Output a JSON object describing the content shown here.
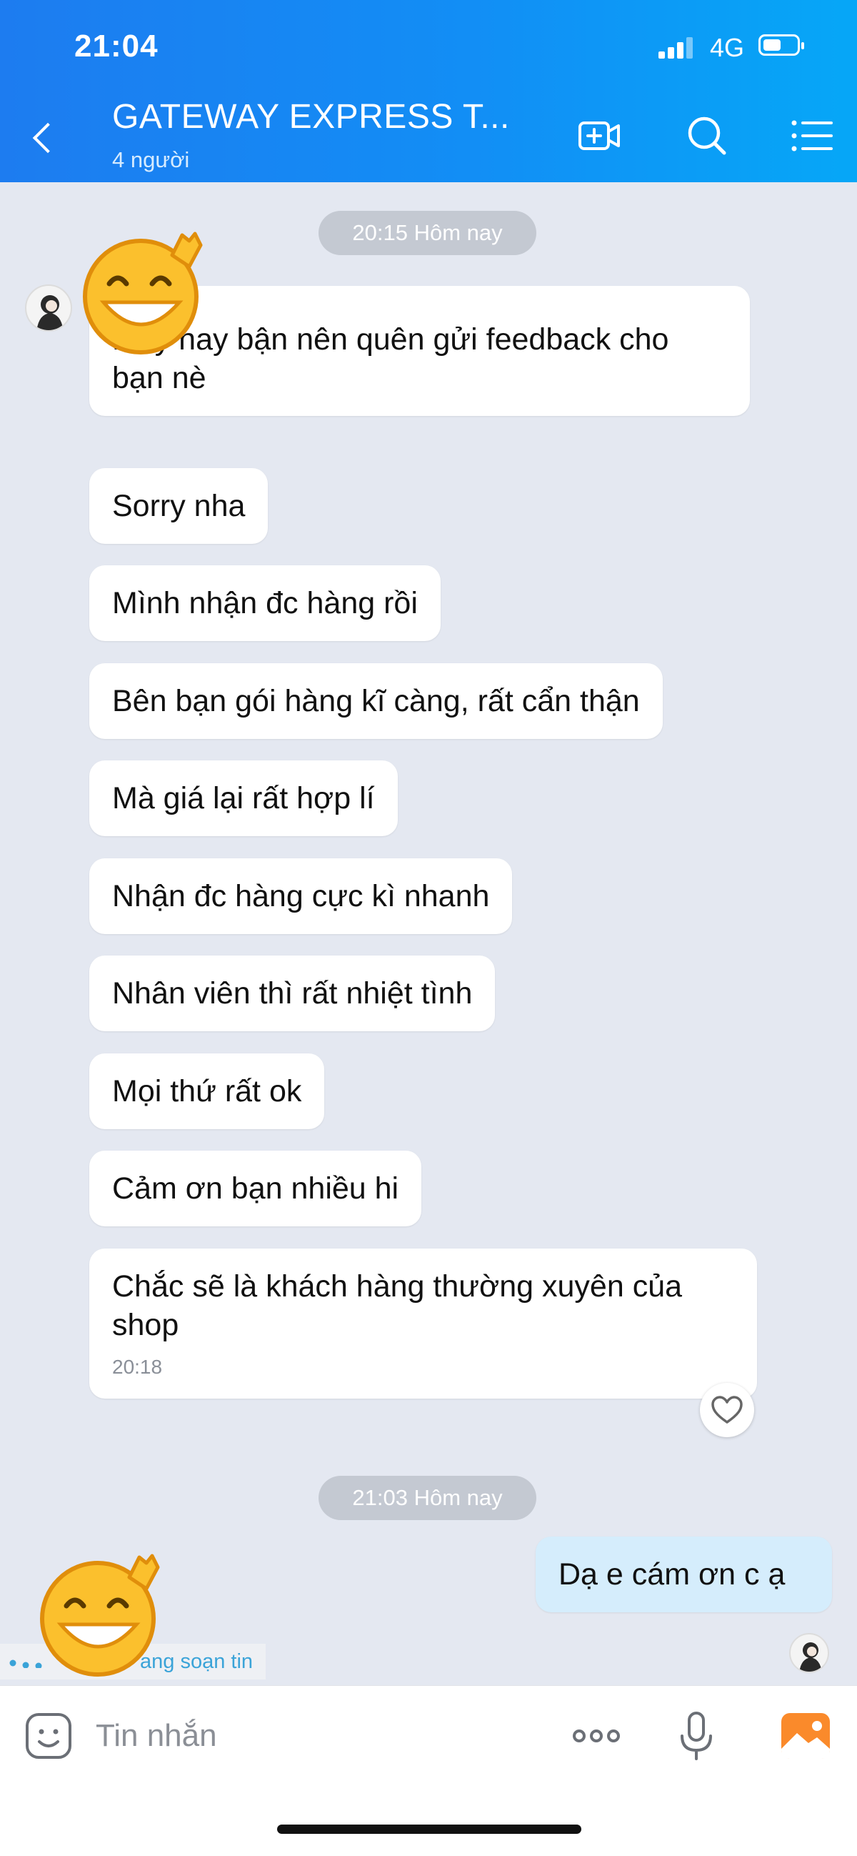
{
  "status_bar": {
    "time": "21:04",
    "network": "4G"
  },
  "header": {
    "title": "GATEWAY EXPRESS  T...",
    "subtitle": "4 người"
  },
  "chat": {
    "date_1": "20:15 Hôm nay",
    "messages": [
      {
        "text": "Mấy nay bận nên quên gửi feedback cho bạn nè"
      },
      {
        "text": "Sorry nha"
      },
      {
        "text": "Mình nhận đc hàng rồi"
      },
      {
        "text": "Bên bạn gói hàng kĩ càng, rất cẩn thận"
      },
      {
        "text": "Mà giá lại rất hợp lí"
      },
      {
        "text": "Nhận đc hàng cực kì nhanh"
      },
      {
        "text": "Nhân viên thì rất nhiệt tình"
      },
      {
        "text": "Mọi thứ rất ok"
      },
      {
        "text": "Cảm ơn bạn nhiều hi"
      },
      {
        "text": "Chắc sẽ là khách hàng thường xuyên của shop",
        "time": "20:18"
      }
    ],
    "date_2": "21:03 Hôm nay",
    "outgoing": {
      "text": "Dạ e cám ơn c ạ"
    },
    "typing": "ang soạn tin"
  },
  "input_bar": {
    "placeholder": "Tin nhắn"
  },
  "colors": {
    "header_start": "#1d7cf0",
    "header_end": "#06a7f7",
    "outgoing_bubble": "#d5edfc",
    "chat_bg": "#e4e8f1"
  },
  "icons": [
    "back-icon",
    "video-call-icon",
    "search-icon",
    "menu-icon",
    "heart-icon",
    "sticker-icon",
    "more-icon",
    "mic-icon",
    "image-icon"
  ]
}
